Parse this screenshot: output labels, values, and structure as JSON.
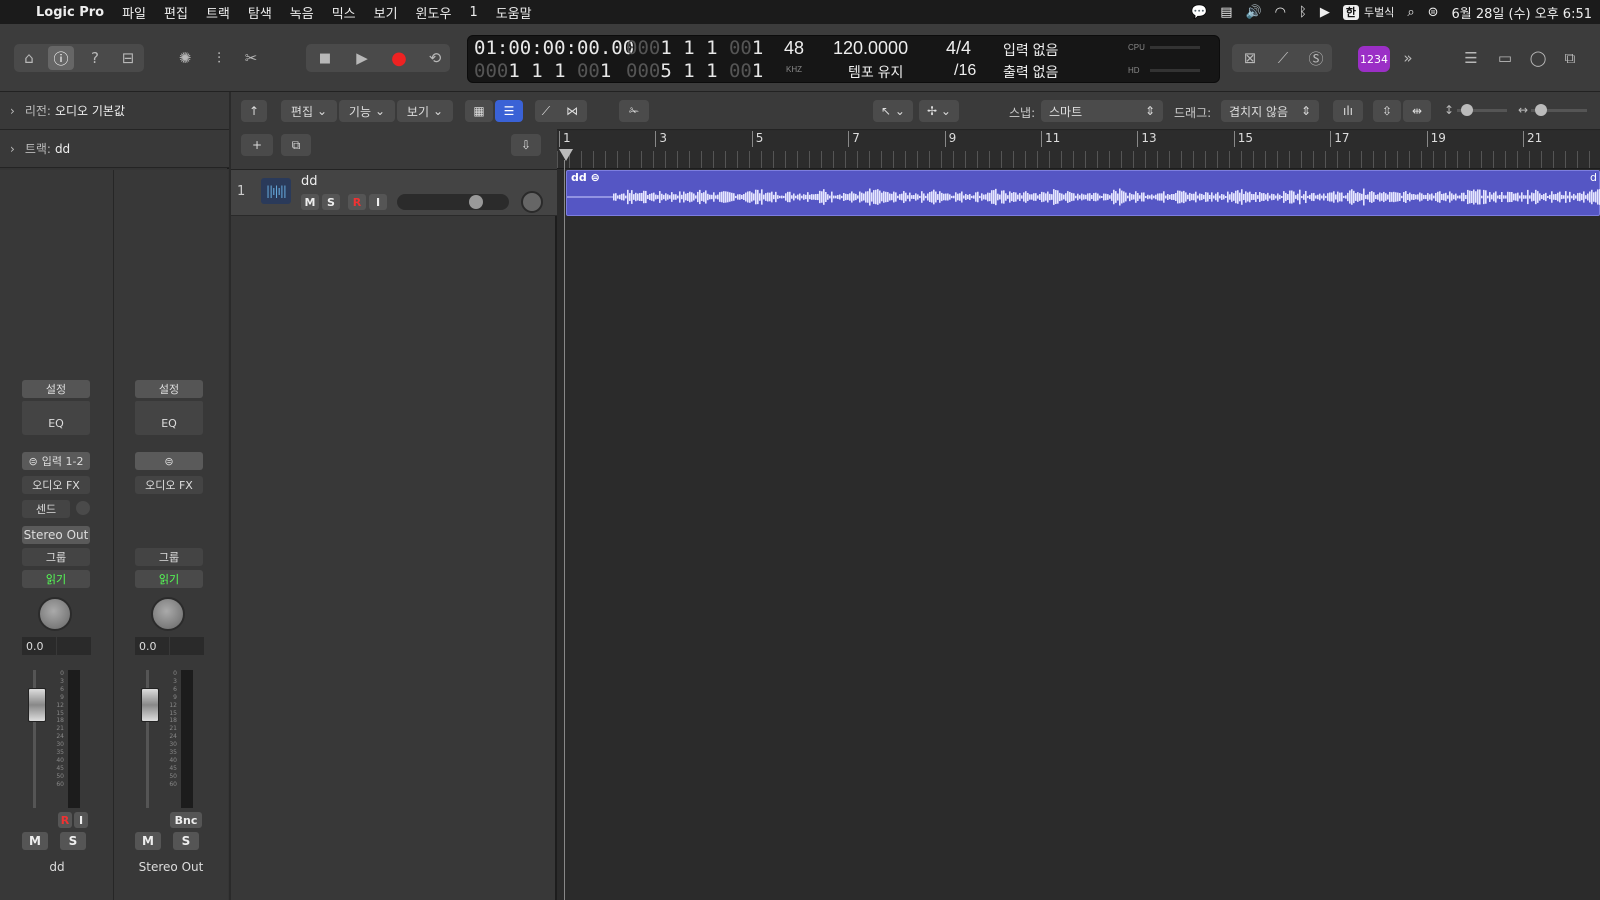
{
  "menubar": {
    "app": "Logic Pro",
    "items": [
      "파일",
      "편집",
      "트랙",
      "탐색",
      "녹음",
      "믹스",
      "보기",
      "윈도우",
      "1",
      "도움말"
    ],
    "input_source_badge": "한",
    "input_method": "두벌식",
    "datetime": "6월 28일 (수) 오후 6:51"
  },
  "lcd": {
    "smpte": "01:00:00:00.00",
    "pos1_dim": "000",
    "pos1": "1 1 1",
    "pos1_sub_dim": "00",
    "pos1_sub": "1",
    "pos2_dim": "000",
    "pos2": "1 1 1",
    "pos2_sub_dim": "00",
    "pos2_sub": "1",
    "end1_dim": "000",
    "end1": "1 1 1",
    "end1_sub_dim": "00",
    "end1_sub": "1",
    "end2_dim": "000",
    "end2": "5 1 1",
    "end2_sub_dim": "00",
    "end2_sub": "1",
    "sample_rate": "48",
    "sample_unit": "KHZ",
    "tempo": "120.0000",
    "tempo_mode": "템포 유지",
    "time_sig": "4/4",
    "division": "/16",
    "input": "입력 없음",
    "output": "출력 없음",
    "cpu_label": "CPU",
    "hd_label": "HD"
  },
  "badge_1234": "1234",
  "inspector": {
    "region_label": "리전:",
    "region_value": "오디오 기본값",
    "track_label": "트랙:",
    "track_value": "dd"
  },
  "strip1": {
    "setting": "설정",
    "eq": "EQ",
    "input": "입력 1-2",
    "audio_fx": "오디오 FX",
    "send": "센드",
    "output": "Stereo Out",
    "group": "그룹",
    "automation": "읽기",
    "pan_value": "0.0",
    "r": "R",
    "i": "I",
    "m": "M",
    "s": "S",
    "name": "dd"
  },
  "strip2": {
    "setting": "설정",
    "eq": "EQ",
    "audio_fx": "오디오 FX",
    "group": "그룹",
    "automation": "읽기",
    "pan_value": "0.0",
    "bnc": "Bnc",
    "m": "M",
    "s": "S",
    "name": "Stereo Out"
  },
  "meter_scale": [
    "0",
    "3",
    "6",
    "9",
    "12",
    "15",
    "18",
    "21",
    "24",
    "30",
    "35",
    "40",
    "45",
    "50",
    "60"
  ],
  "toolbar": {
    "edit": "편집",
    "functions": "기능",
    "view": "보기",
    "snap_label": "스냅:",
    "snap_value": "스마트",
    "drag_label": "드래그:",
    "drag_value": "겹치지 않음"
  },
  "track": {
    "number": "1",
    "name": "dd",
    "m": "M",
    "s": "S",
    "r": "R",
    "i": "I"
  },
  "ruler": {
    "bars": [
      "1",
      "3",
      "5",
      "7",
      "9",
      "11",
      "13",
      "15",
      "17",
      "19",
      "21"
    ]
  },
  "region": {
    "name": "dd",
    "tail_label": "d"
  }
}
